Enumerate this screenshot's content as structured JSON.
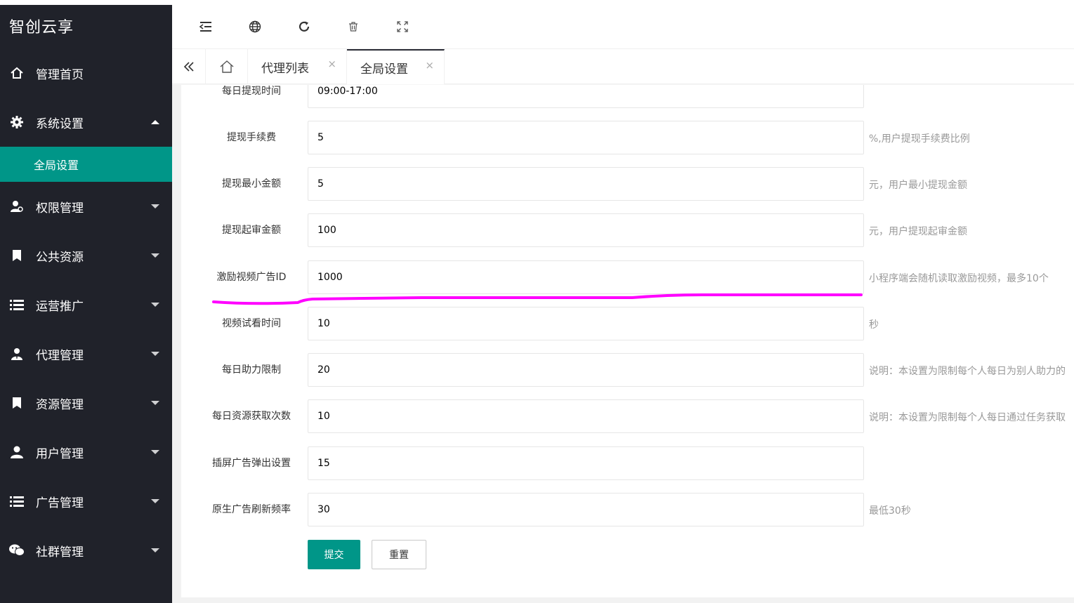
{
  "app": {
    "title": "智创云享"
  },
  "sidebar": {
    "items": [
      {
        "label": "管理首页",
        "icon": "home-icon"
      },
      {
        "label": "系统设置",
        "icon": "gear-icon",
        "expanded": true,
        "children": [
          {
            "label": "全局设置",
            "active": true
          }
        ]
      },
      {
        "label": "权限管理",
        "icon": "user-key-icon"
      },
      {
        "label": "公共资源",
        "icon": "bookmark-icon"
      },
      {
        "label": "运营推广",
        "icon": "list-icon"
      },
      {
        "label": "代理管理",
        "icon": "user-tie-icon"
      },
      {
        "label": "资源管理",
        "icon": "bookmark-icon"
      },
      {
        "label": "用户管理",
        "icon": "user-icon"
      },
      {
        "label": "广告管理",
        "icon": "list-icon"
      },
      {
        "label": "社群管理",
        "icon": "wechat-icon"
      }
    ]
  },
  "toolbar": {
    "icons": [
      "collapse-menu-icon",
      "globe-icon",
      "refresh-icon",
      "trash-icon",
      "fullscreen-icon"
    ]
  },
  "tabs": [
    {
      "label": "代理列表",
      "close": "×"
    },
    {
      "label": "全局设置",
      "close": "×",
      "active": true
    }
  ],
  "form": {
    "rows": [
      {
        "label": "每日提现时间",
        "value": "09:00-17:00",
        "aux": ""
      },
      {
        "label": "提现手续费",
        "value": "5",
        "aux": "%,用户提现手续费比例"
      },
      {
        "label": "提现最小金额",
        "value": "5",
        "aux": "元，用户最小提现金额"
      },
      {
        "label": "提现起审金额",
        "value": "100",
        "aux": "元，用户提现起审金额"
      },
      {
        "label": "激励视频广告ID",
        "value": "1000",
        "aux": "小程序端会随机读取激励视频，最多10个"
      },
      {
        "label": "视频试看时间",
        "value": "10",
        "aux": "秒"
      },
      {
        "label": "每日助力限制",
        "value": "20",
        "aux": "说明：本设置为限制每个人每日为别人助力的"
      },
      {
        "label": "每日资源获取次数",
        "value": "10",
        "aux": "说明：本设置为限制每个人每日通过任务获取"
      },
      {
        "label": "插屏广告弹出设置",
        "value": "15",
        "aux": ""
      },
      {
        "label": "原生广告刷新频率",
        "value": "30",
        "aux": "最低30秒"
      }
    ],
    "submit_label": "提交",
    "reset_label": "重置"
  },
  "colors": {
    "sidebar_bg": "#20222a",
    "accent": "#009688",
    "annotation": "#ff00ff"
  }
}
